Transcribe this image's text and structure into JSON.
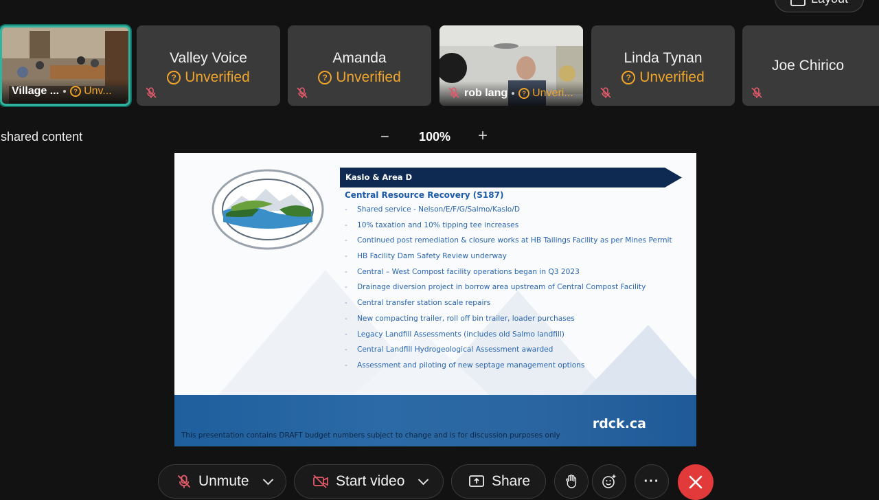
{
  "header": {
    "layout_label": "Layout"
  },
  "participants": [
    {
      "name": "Village ...",
      "status": "Unv...",
      "has_video": true
    },
    {
      "name": "Valley Voice",
      "status": "Unverified",
      "has_video": false
    },
    {
      "name": "Amanda",
      "status": "Unverified",
      "has_video": false
    },
    {
      "name": "rob lang",
      "status": "Unveri...",
      "has_video": true
    },
    {
      "name": "Linda Tynan",
      "status": "Unverified",
      "has_video": false
    },
    {
      "name": "Joe Chirico",
      "status": "",
      "has_video": false
    }
  ],
  "shared": {
    "label": "shared content",
    "zoom_minus": "−",
    "zoom_level": "100%",
    "zoom_plus": "+"
  },
  "slide": {
    "banner": "Kaslo & Area D",
    "heading": "Central Resource Recovery (S187)",
    "bullets": [
      "Shared service - Nelson/E/F/G/Salmo/Kaslo/D",
      "10% taxation and 10% tipping tee increases",
      "Continued post remediation & closure works at HB Tailings Facility as per Mines Permit",
      "HB Facility Dam Safety Review underway",
      "Central – West Compost facility operations began in Q3 2023",
      "Drainage diversion project in borrow area upstream of Central Compost Facility",
      "Central transfer station scale repairs",
      "New compacting trailer, roll off bin trailer, loader purchases",
      "Legacy Landfill Assessments (includes old Salmo landfill)",
      "Central Landfill Hydrogeological Assessment awarded",
      "Assessment and piloting of new septage management options"
    ],
    "bullet_marker": "-",
    "logo_top": "REGIONAL DISTRICT",
    "logo_bottom": "CENTRAL KOOTENAY",
    "footer_url": "rdck.ca",
    "footer_note": "This presentation contains DRAFT budget numbers subject to change and is for discussion purposes only"
  },
  "toolbar": {
    "unmute_label": "Unmute",
    "start_video_label": "Start video",
    "share_label": "Share",
    "more_label": "···"
  },
  "colors": {
    "unverified": "#f0a52a",
    "active_border": "#2fb4a0",
    "end_call": "#e23a3a",
    "slide_banner": "#0f2a52",
    "slide_text": "#2764b0"
  }
}
